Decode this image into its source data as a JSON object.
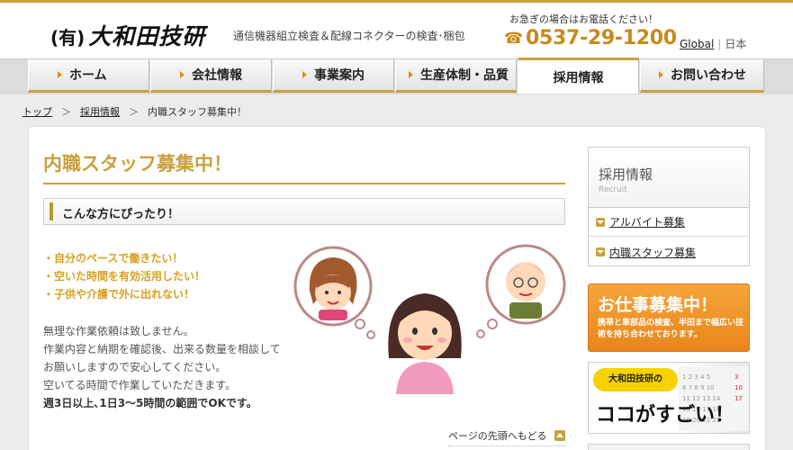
{
  "header": {
    "logo_paren": "(有)",
    "logo_main": "大和田技研",
    "tagline": "通信機器組立検査＆配線コネクターの検査･梱包",
    "hurry_text": "お急ぎの場合はお電話ください！",
    "phone": "0537-29-1200",
    "lang_global": "Global",
    "lang_japan": "日本"
  },
  "nav": {
    "items": [
      {
        "label": "ホーム"
      },
      {
        "label": "会社情報"
      },
      {
        "label": "事業案内"
      },
      {
        "label": "生産体制・品質"
      },
      {
        "label": "採用情報"
      },
      {
        "label": "お問い合わせ"
      }
    ]
  },
  "breadcrumb": {
    "home": "トップ",
    "recruit": "採用情報",
    "current": "内職スタッフ募集中！",
    "separator": "＞"
  },
  "main": {
    "title": "内職スタッフ募集中！",
    "subhead": "こんな方にぴったり！",
    "bullets": [
      "・自分のペースで働きたい！",
      "・空いた時間を有効活用したい！",
      "・子供や介護で外に出れない！"
    ],
    "body_lines": [
      "無理な作業依頼は致しません。",
      "作業内容と納期を確認後、出来る数量を相談して",
      "お願いしますので安心してください。",
      "空いてる時間で作業していただきます。"
    ],
    "body_strong": "週3日以上､1日3～5時間の範囲でOKです。",
    "page_top": "ページの先頭へもどる"
  },
  "sidebar": {
    "title": "採用情報",
    "subtitle": "Recruit",
    "links": [
      {
        "label": "アルバイト募集"
      },
      {
        "label": "内職スタッフ募集"
      }
    ],
    "banner1_big": "お仕事募集中！",
    "banner1_small": "携帯と車部品の検査、半田まで幅広い技術を持ち合わせております。",
    "banner2_badge": "大和田技研の",
    "banner2_big": "ココがすごい！"
  },
  "colors": {
    "accent": "#c9a13c",
    "phone": "#c98a1a",
    "orange": "#e8861b"
  }
}
